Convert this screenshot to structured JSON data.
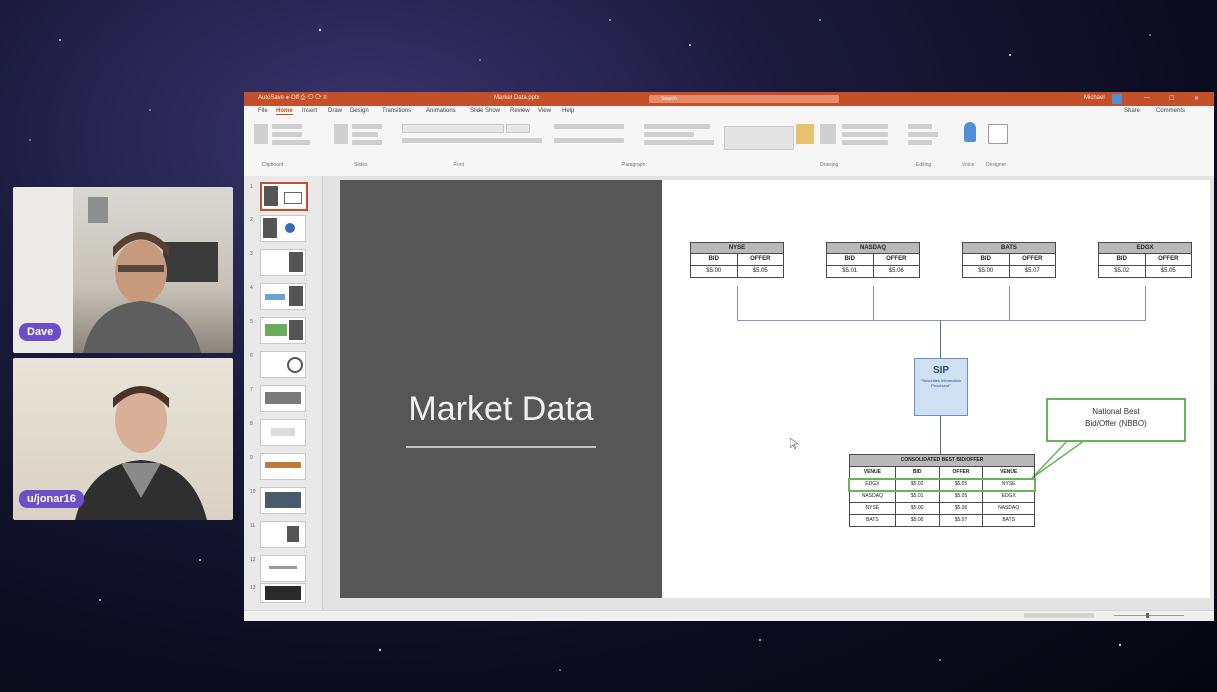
{
  "participants": [
    {
      "name": "Dave"
    },
    {
      "name": "u/jonar16"
    }
  ],
  "powerpoint": {
    "titlebar": {
      "left": "AutoSave ● Off  ⎙ ⟲ ⟳ ≡",
      "center": "Market Data.pptx",
      "search": "Search",
      "user": "Michael"
    },
    "menu": [
      "File",
      "Home",
      "Insert",
      "Draw",
      "Design",
      "Transitions",
      "Animations",
      "Slide Show",
      "Review",
      "View",
      "Help"
    ],
    "menu_right": [
      "Share",
      "Comments"
    ],
    "ribbon_groups": [
      "Clipboard",
      "Slides",
      "Font",
      "Paragraph",
      "Drawing",
      "Editing",
      "Voice",
      "Designer"
    ],
    "slide_numbers": [
      "1",
      "2",
      "3",
      "4",
      "5",
      "6",
      "7",
      "8",
      "9",
      "10",
      "11",
      "12",
      "13"
    ]
  },
  "slide": {
    "title": "Market Data",
    "exchanges": [
      {
        "name": "NYSE",
        "bid_label": "BID",
        "offer_label": "OFFER",
        "bid": "$5.00",
        "offer": "$5.05"
      },
      {
        "name": "NASDAQ",
        "bid_label": "BID",
        "offer_label": "OFFER",
        "bid": "$5.01",
        "offer": "$5.06"
      },
      {
        "name": "BATS",
        "bid_label": "BID",
        "offer_label": "OFFER",
        "bid": "$5.00",
        "offer": "$5.07"
      },
      {
        "name": "EDGX",
        "bid_label": "BID",
        "offer_label": "OFFER",
        "bid": "$5.02",
        "offer": "$5.05"
      }
    ],
    "sip": {
      "title": "SIP",
      "subtitle": "\"Securities Information Processor\""
    },
    "nbbo_callout": {
      "line1": "National Best",
      "line2": "Bid/Offer (NBBO)"
    },
    "consolidated": {
      "title": "CONSOLIDATED BEST BID/OFFER",
      "headers": [
        "VENUE",
        "BID",
        "OFFER",
        "VENUE"
      ],
      "rows": [
        [
          "EDGX",
          "$5.02",
          "$5.05",
          "NYSE"
        ],
        [
          "NASDAQ",
          "$5.01",
          "$5.05",
          "EDGX"
        ],
        [
          "NYSE",
          "$5.00",
          "$5.06",
          "NASDAQ"
        ],
        [
          "BATS",
          "$5.00",
          "$5.07",
          "BATS"
        ]
      ]
    }
  }
}
